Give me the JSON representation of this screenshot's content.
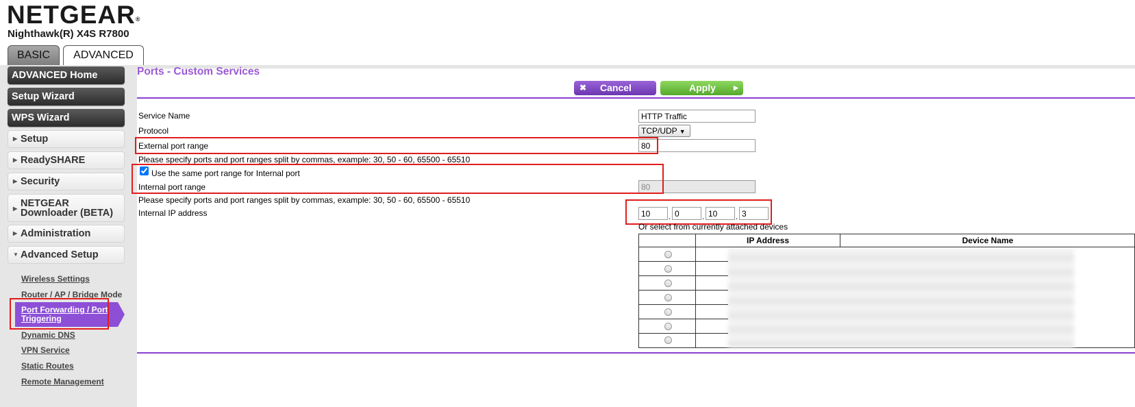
{
  "brand": {
    "logo": "NETGEAR",
    "reg": "®",
    "model": "Nighthawk(R) X4S R7800"
  },
  "tabs": {
    "basic": "BASIC",
    "advanced": "ADVANCED"
  },
  "nav": {
    "top_buttons": [
      "ADVANCED Home",
      "Setup Wizard",
      "WPS Wizard"
    ],
    "sections": {
      "setup": "Setup",
      "readyshare": "ReadySHARE",
      "security": "Security",
      "downloader_l1": "NETGEAR",
      "downloader_l2": "Downloader (BETA)",
      "administration": "Administration",
      "advanced_setup": "Advanced Setup"
    },
    "sub": {
      "wireless": "Wireless Settings",
      "router_ap": "Router / AP / Bridge Mode",
      "pf_l1": "Port Forwarding / Port",
      "pf_l2": "Triggering",
      "ddns": "Dynamic DNS",
      "vpn": "VPN Service",
      "static": "Static Routes",
      "remote": "Remote Management"
    }
  },
  "main": {
    "title": "Ports - Custom Services",
    "cancel": "Cancel",
    "apply": "Apply",
    "service_name_label": "Service Name",
    "service_name_value": "HTTP Traffic",
    "protocol_label": "Protocol",
    "protocol_value": "TCP/UDP",
    "ext_range_label": "External port range",
    "ext_range_value": "80",
    "hint1": "Please specify ports and port ranges split by commas, example: 30, 50 - 60, 65500 - 65510",
    "same_port_label": "Use the same port range for Internal port",
    "int_range_label": "Internal port range",
    "int_range_value": "80",
    "hint2": "Please specify ports and port ranges split by commas, example: 30, 50 - 60, 65500 - 65510",
    "ip_label": "Internal IP address",
    "ip": [
      "10",
      "0",
      "10",
      "3"
    ],
    "ip_sep": ".",
    "or_select": "Or select from currently attached devices",
    "table_headers": {
      "ip": "IP Address",
      "device": "Device Name"
    }
  }
}
